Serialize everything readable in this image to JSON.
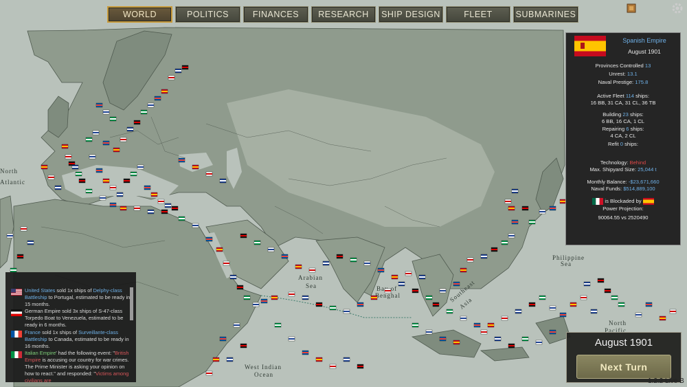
{
  "tabs": [
    {
      "label": "WORLD",
      "active": true
    },
    {
      "label": "POLITICS"
    },
    {
      "label": "FINANCES"
    },
    {
      "label": "RESEARCH"
    },
    {
      "label": "SHIP DESIGN"
    },
    {
      "label": "FLEET"
    },
    {
      "label": "SUBMARINES"
    }
  ],
  "map_labels": {
    "north_atlantic_1": "North",
    "north_atlantic_2": "Atlantic",
    "arabian_1": "Arabian",
    "arabian_2": "Sea",
    "bay_1": "Bay of",
    "bay_2": "Benghal",
    "philippine_1": "Philippine",
    "philippine_2": "Sea",
    "north_pacific_1": "North",
    "north_pacific_2": "Pacific",
    "west_indian_1": "West Indian",
    "west_indian_2": "Ocean",
    "southeast_asia_1": "Southeast",
    "southeast_asia_2": "Asia"
  },
  "info": {
    "nation": "Spanish Empire",
    "date": "August 1901",
    "provinces_label": "Provinces Controlled",
    "provinces_value": "13",
    "unrest_label": "Unrest:",
    "unrest_value": "13.1",
    "prestige_label": "Naval Prestige:",
    "prestige_value": "175.8",
    "fleet_label": "Active Fleet",
    "fleet_value": "114",
    "fleet_suffix": "ships:",
    "fleet_breakdown": "16 BB, 31 CA, 31 CL, 36 TB",
    "building_label": "Building",
    "building_value": "23",
    "building_suffix": "ships:",
    "building_breakdown": "6 BB, 16 CA, 1 CL",
    "repairing_label": "Repairing",
    "repairing_value": "6",
    "repairing_suffix": "ships:",
    "repairing_breakdown": "4 CA, 2 CL",
    "refit_label": "Refit",
    "refit_value": "0",
    "refit_suffix": "ships:",
    "tech_label": "Technology:",
    "tech_value": "Behind",
    "shipyard_label": "Max. Shipyard Size:",
    "shipyard_value": "25,044 t",
    "balance_label": "Monthly Balance:",
    "balance_value": "-$23,671,660",
    "funds_label": "Naval Funds:",
    "funds_value": "$514,889,100",
    "blockade_text": "is Blockaded by",
    "projection_label": "Power Projection:",
    "projection_value": "90064.55 vs 2520490"
  },
  "log": [
    {
      "flag": "us",
      "n": "United States",
      "a": " sold 1x ships of ",
      "s": "Delphy-class Battleship",
      "b": " to Portugal, estimated to be ready in 15 months."
    },
    {
      "flag": "de",
      "n": "German Empire",
      "a": " sold 3x ships of S-47-class Torpedo Boat to Venezuela, estimated to be ready in 6 months."
    },
    {
      "flag": "fr",
      "n": "France",
      "a": " sold 1x ships of ",
      "s": "Surveillante-class Battleship",
      "b": " to Canada, estimated to be ready in 16 months."
    },
    {
      "flag": "it",
      "n": "Italian Empire",
      "a": "' had the following event: \"",
      "s": "British Empire",
      "b": " is accusing our country for war crimes. The Prime Minister is asking your opinion on how to react.\" and responded: \"",
      "s2": "Victims among civilians are"
    }
  ],
  "turn": {
    "date": "August 1901",
    "button": "Next Turn"
  },
  "version": "1.2.2 Live B",
  "colors": {
    "accent": "#c79a3a",
    "panel": "#181818",
    "link": "#6fb1e8",
    "alert": "#e04848",
    "sea": "#b9c2bb",
    "land": "#8c9a8b"
  }
}
